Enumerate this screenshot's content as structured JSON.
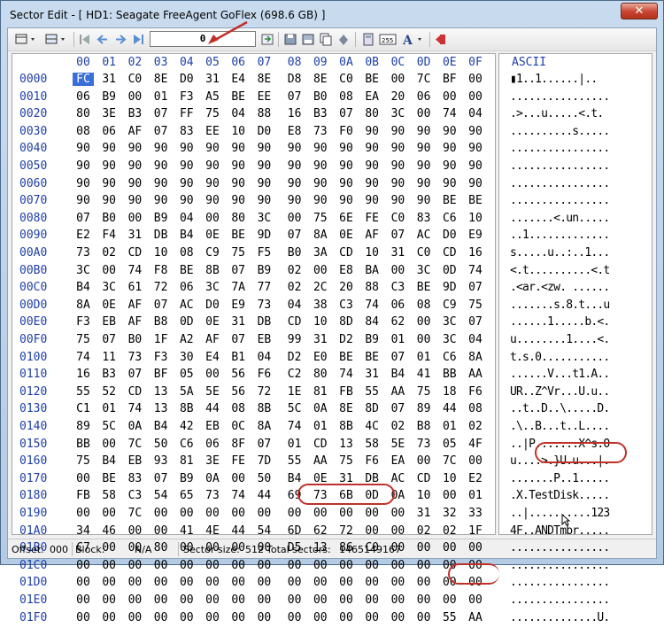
{
  "window": {
    "title": "Sector Edit - [ HD1: Seagate FreeAgent GoFlex (698.6 GB) ]",
    "close_glyph": "✕"
  },
  "toolbar": {
    "sector_value": "0",
    "icons": [
      "view-menu-icon",
      "layout-menu-icon",
      "first-sector-icon",
      "prev-sector-icon",
      "next-sector-icon",
      "last-sector-icon",
      "goto-icon",
      "save-icon",
      "save-all-icon",
      "copy-icon",
      "fill-icon",
      "calculator-icon",
      "ascii-icon",
      "font-icon",
      "undo-icon"
    ]
  },
  "colors": {
    "accent": "#1e3ea8",
    "selection": "#3a6ed8",
    "annotation": "#c0302a"
  },
  "hex_header": {
    "columns": [
      "00",
      "01",
      "02",
      "03",
      "04",
      "05",
      "06",
      "07",
      "08",
      "09",
      "0A",
      "0B",
      "0C",
      "0D",
      "0E",
      "0F"
    ],
    "ascii_label": "ASCII"
  },
  "rows": [
    {
      "off": "0000",
      "b": "FC 31 C0 8E D0 31 E4 8E D8 8E C0 BE 00 7C BF 00",
      "a": "▮1..1......|.."
    },
    {
      "off": "0010",
      "b": "06 B9 00 01 F3 A5 BE EE 07 B0 08 EA 20 06 00 00",
      "a": "................"
    },
    {
      "off": "0020",
      "b": "80 3E B3 07 FF 75 04 88 16 B3 07 80 3C 00 74 04",
      "a": ".>...u.....<.t."
    },
    {
      "off": "0030",
      "b": "08 06 AF 07 83 EE 10 D0 E8 73 F0 90 90 90 90 90",
      "a": "..........s....."
    },
    {
      "off": "0040",
      "b": "90 90 90 90 90 90 90 90 90 90 90 90 90 90 90 90",
      "a": "................"
    },
    {
      "off": "0050",
      "b": "90 90 90 90 90 90 90 90 90 90 90 90 90 90 90 90",
      "a": "................"
    },
    {
      "off": "0060",
      "b": "90 90 90 90 90 90 90 90 90 90 90 90 90 90 90 90",
      "a": "................"
    },
    {
      "off": "0070",
      "b": "90 90 90 90 90 90 90 90 90 90 90 90 90 90 BE BE",
      "a": "................"
    },
    {
      "off": "0080",
      "b": "07 B0 00 B9 04 00 80 3C 00 75 6E FE C0 83 C6 10",
      "a": ".......<.un....."
    },
    {
      "off": "0090",
      "b": "E2 F4 31 DB B4 0E BE 9D 07 8A 0E AF 07 AC D0 E9",
      "a": "..1............."
    },
    {
      "off": "00A0",
      "b": "73 02 CD 10 08 C9 75 F5 B0 3A CD 10 31 C0 CD 16",
      "a": "s.....u..:..1..."
    },
    {
      "off": "00B0",
      "b": "3C 00 74 F8 BE 8B 07 B9 02 00 E8 BA 00 3C 0D 74",
      "a": "<.t..........<.t"
    },
    {
      "off": "00C0",
      "b": "B4 3C 61 72 06 3C 7A 77 02 2C 20 88 C3 BE 9D 07",
      "a": ".<ar.<zw. ......"
    },
    {
      "off": "00D0",
      "b": "8A 0E AF 07 AC D0 E9 73 04 38 C3 74 06 08 C9 75",
      "a": ".......s.8.t...u"
    },
    {
      "off": "00E0",
      "b": "F3 EB AF B8 0D 0E 31 DB CD 10 8D 84 62 00 3C 07",
      "a": "......1.....b.<."
    },
    {
      "off": "00F0",
      "b": "75 07 B0 1F A2 AF 07 EB 99 31 D2 B9 01 00 3C 04",
      "a": "u........1....<."
    },
    {
      "off": "0100",
      "b": "74 11 73 F3 30 E4 B1 04 D2 E0 BE BE 07 01 C6 8A",
      "a": "t.s.0..........."
    },
    {
      "off": "0110",
      "b": "16 B3 07 BF 05 00 56 F6 C2 80 74 31 B4 41 BB AA",
      "a": "......V...t1.A.."
    },
    {
      "off": "0120",
      "b": "55 52 CD 13 5A 5E 56 72 1E 81 FB 55 AA 75 18 F6",
      "a": "UR..Z^Vr...U.u.."
    },
    {
      "off": "0130",
      "b": "C1 01 74 13 8B 44 08 8B 5C 0A 8E 8D 07 89 44 08",
      "a": "..t..D..\\.....D."
    },
    {
      "off": "0140",
      "b": "89 5C 0A B4 42 EB 0C 8A 74 01 8B 4C 02 B8 01 02",
      "a": ".\\..B...t..L...."
    },
    {
      "off": "0150",
      "b": "BB 00 7C 50 C6 06 8F 07 01 CD 13 58 5E 73 05 4F",
      "a": "..|P.......X^s.O"
    },
    {
      "off": "0160",
      "b": "75 B4 EB 93 81 3E FE 7D 55 AA 75 F6 EA 00 7C 00",
      "a": "u....>.}U.u...|."
    },
    {
      "off": "0170",
      "b": "00 BE 83 07 B9 0A 00 50 B4 0E 31 DB AC CD 10 E2",
      "a": ".......P..1....."
    },
    {
      "off": "0180",
      "b": "FB 58 C3 54 65 73 74 44 69 73 6B 0D 0A 10 00 01",
      "a": ".X.TestDisk....."
    },
    {
      "off": "0190",
      "b": "00 00 7C 00 00 00 00 00 00 00 00 00 00 31 32 33",
      "a": "..|..........123"
    },
    {
      "off": "01A0",
      "b": "34 46 00 00 41 4E 44 54 6D 62 72 00 00 02 02 1F",
      "a": "4F..ANDTmbr....."
    },
    {
      "off": "01B0",
      "b": "C7 00 00 80 00 00 00 00 D5 13 86 C0 00 00 00 00",
      "a": "................"
    },
    {
      "off": "01C0",
      "b": "00 00 00 00 00 00 00 00 00 00 00 00 00 00 00 00",
      "a": "................"
    },
    {
      "off": "01D0",
      "b": "00 00 00 00 00 00 00 00 00 00 00 00 00 00 00 00",
      "a": "................"
    },
    {
      "off": "01E0",
      "b": "00 00 00 00 00 00 00 00 00 00 00 00 00 00 00 00",
      "a": "................"
    },
    {
      "off": "01F0",
      "b": "00 00 00 00 00 00 00 00 00 00 00 00 00 00 55 AA",
      "a": "..............U."
    }
  ],
  "status": {
    "offset_label": "Offset:",
    "offset_value": "000",
    "block_label": "Block:",
    "block_value": "N/A",
    "sector_size_label": "Sector size:",
    "sector_size_value": "512",
    "total_sectors_label": "Total sectors:",
    "total_sectors_value": "1465149167"
  }
}
